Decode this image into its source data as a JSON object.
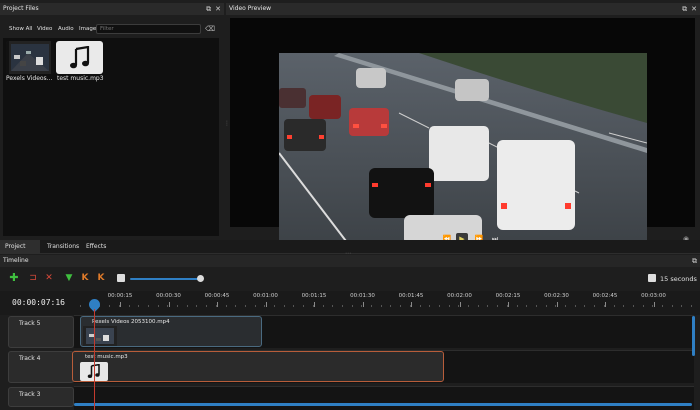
{
  "project_files": {
    "title": "Project Files",
    "filter_tabs": [
      "Show All",
      "Video",
      "Audio",
      "Image"
    ],
    "filter_placeholder": "Filter",
    "files": [
      {
        "name": "Pexels Videos...",
        "kind": "video"
      },
      {
        "name": "test music.mp3",
        "kind": "audio"
      }
    ]
  },
  "video_preview": {
    "title": "Video Preview"
  },
  "bottom_tabs": [
    "Project Files",
    "Transitions",
    "Effects"
  ],
  "timeline": {
    "title": "Timeline",
    "current_time": "00:00:07:16",
    "zoom_label": "15 seconds",
    "ruler": [
      "00:00:15",
      "00:00:30",
      "00:00:45",
      "00:01:00",
      "00:01:15",
      "00:01:30",
      "00:01:45",
      "00:02:00",
      "00:02:15",
      "00:02:30",
      "00:02:45",
      "00:03:00"
    ],
    "tracks": [
      {
        "label": "Track 5",
        "clip": "Pexels Videos 2053100.mp4"
      },
      {
        "label": "Track 4",
        "clip": "test music.mp3"
      },
      {
        "label": "Track 3",
        "clip": ""
      }
    ]
  },
  "colors": {
    "accent_blue": "#2f7fc4",
    "add_green": "#3fbf3f",
    "remove_red": "#d94a3a",
    "marker_orange": "#e07b2a",
    "playhead": "#c43b2e",
    "audio_clip_border": "#b85d3a"
  }
}
